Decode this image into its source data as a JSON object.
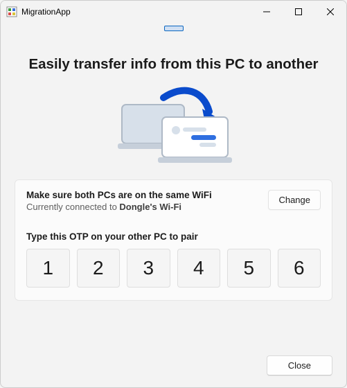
{
  "window": {
    "title": "MigrationApp"
  },
  "headline": "Easily transfer info from this PC to another",
  "card": {
    "wifi_title": "Make sure both PCs are on the same WiFi",
    "wifi_status_prefix": "Currently connected to ",
    "wifi_name": "Dongle's Wi-Fi",
    "change_label": "Change",
    "otp_label": "Type this OTP on your other PC to pair",
    "otp": [
      "1",
      "2",
      "3",
      "4",
      "5",
      "6"
    ]
  },
  "footer": {
    "close_label": "Close"
  }
}
